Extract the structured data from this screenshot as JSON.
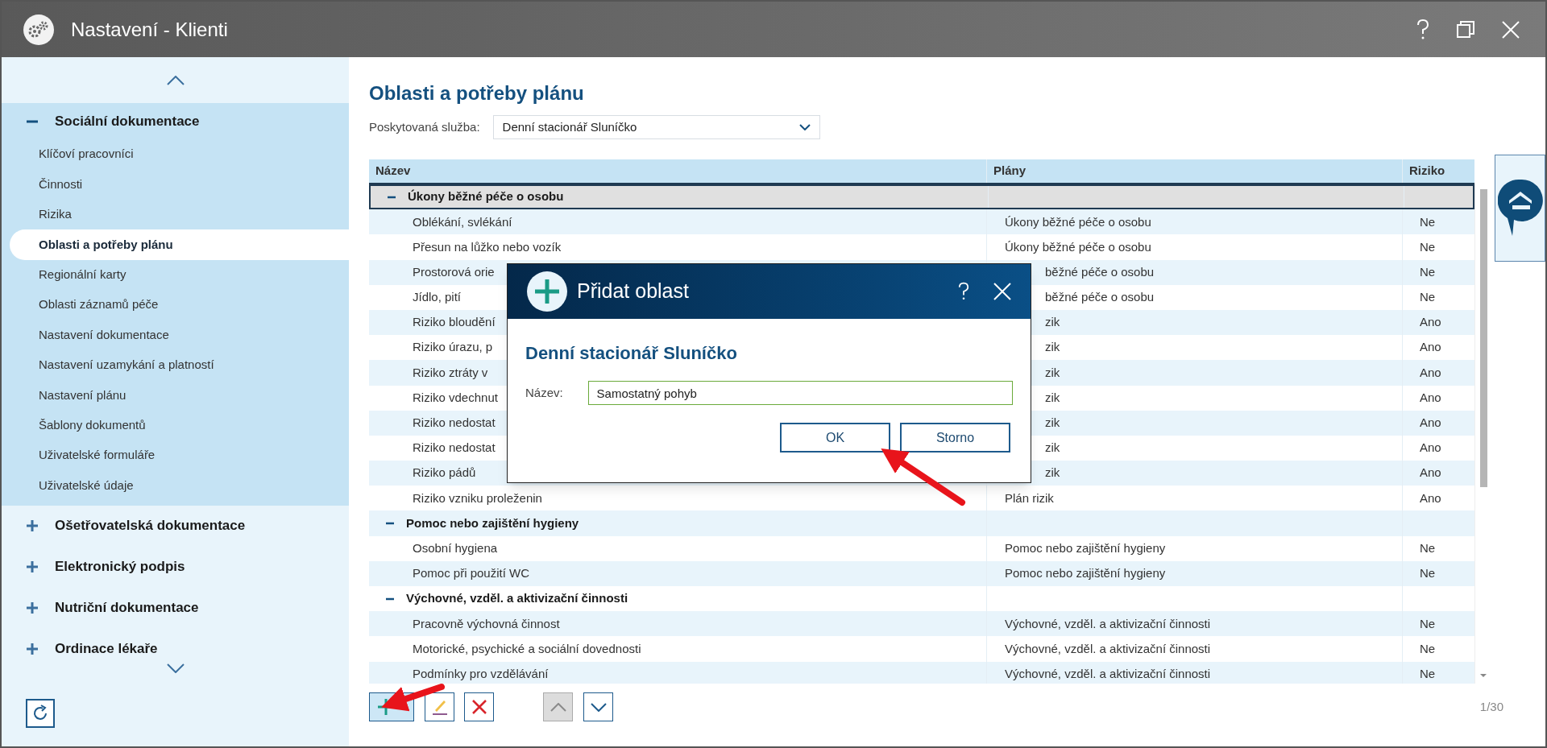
{
  "window": {
    "title": "Nastavení - Klienti"
  },
  "sidebar": {
    "sections": [
      {
        "label": "Sociální dokumentace",
        "expanded": true,
        "children": [
          {
            "label": "Klíčoví pracovníci",
            "selected": false
          },
          {
            "label": "Činnosti",
            "selected": false
          },
          {
            "label": "Rizika",
            "selected": false
          },
          {
            "label": "Oblasti a potřeby plánu",
            "selected": true
          },
          {
            "label": "Regionální karty",
            "selected": false
          },
          {
            "label": "Oblasti záznamů péče",
            "selected": false
          },
          {
            "label": "Nastavení dokumentace",
            "selected": false
          },
          {
            "label": "Nastavení uzamykání a platností",
            "selected": false
          },
          {
            "label": "Nastavení plánu",
            "selected": false
          },
          {
            "label": "Šablony dokumentů",
            "selected": false
          },
          {
            "label": "Uživatelské formuláře",
            "selected": false
          },
          {
            "label": "Uživatelské údaje",
            "selected": false
          }
        ]
      },
      {
        "label": "Ošetřovatelská dokumentace",
        "expanded": false
      },
      {
        "label": "Elektronický podpis",
        "expanded": false
      },
      {
        "label": "Nutriční dokumentace",
        "expanded": false
      },
      {
        "label": "Ordinace lékaře",
        "expanded": false
      }
    ]
  },
  "page": {
    "title": "Oblasti a potřeby plánu",
    "service_label": "Poskytovaná služba:",
    "service_value": "Denní stacionář Sluníčko"
  },
  "table": {
    "columns": [
      "Název",
      "Plány",
      "Riziko"
    ],
    "groups": [
      {
        "name": "Úkony běžné péče o osobu",
        "expanded": true,
        "selected": true,
        "children": [
          {
            "name": "Oblékání, svlékání",
            "plan": "Úkony běžné péče o osobu",
            "risk": "Ne",
            "selected": false
          },
          {
            "name": "Přesun na lůžko nebo vozík",
            "plan": "Úkony běžné péče o osobu",
            "risk": "Ne",
            "selected": false
          },
          {
            "name": "Prostorová orie",
            "plan": "běžné péče o osobu",
            "plan_covered": true,
            "risk": "Ne",
            "selected": false
          },
          {
            "name": "Jídlo, pití",
            "plan": "běžné péče o osobu",
            "plan_covered": true,
            "risk": "Ne",
            "selected": false
          },
          {
            "name": "Riziko bloudění",
            "plan": "zik",
            "plan_covered": true,
            "risk": "Ano",
            "selected": false
          },
          {
            "name": "Riziko úrazu, p",
            "plan": "zik",
            "plan_covered": true,
            "risk": "Ano",
            "selected": false
          },
          {
            "name": "Riziko ztráty v",
            "plan": "zik",
            "plan_covered": true,
            "risk": "Ano",
            "selected": false
          },
          {
            "name": "Riziko vdechnut",
            "plan": "zik",
            "plan_covered": true,
            "risk": "Ano",
            "selected": false
          },
          {
            "name": "Riziko nedostat",
            "plan": "zik",
            "plan_covered": true,
            "risk": "Ano",
            "selected": false
          },
          {
            "name": "Riziko nedostat",
            "plan": "zik",
            "plan_covered": true,
            "risk": "Ano",
            "selected": false
          },
          {
            "name": "Riziko pádů",
            "plan": "zik",
            "plan_covered": true,
            "risk": "Ano",
            "selected": false
          },
          {
            "name": "Riziko vzniku proleženin",
            "plan": "Plán rizik",
            "risk": "Ano",
            "selected": false
          }
        ]
      },
      {
        "name": "Pomoc nebo zajištění hygieny",
        "expanded": true,
        "selected": false,
        "children": [
          {
            "name": "Osobní hygiena",
            "plan": "Pomoc nebo zajištění hygieny",
            "risk": "Ne",
            "selected": false
          },
          {
            "name": "Pomoc při použití WC",
            "plan": "Pomoc nebo zajištění hygieny",
            "risk": "Ne",
            "selected": false
          }
        ]
      },
      {
        "name": "Výchovné, vzděl. a aktivizační činnosti",
        "expanded": true,
        "selected": false,
        "children": [
          {
            "name": "Pracovně výchovná činnost",
            "plan": "Výchovné, vzděl. a aktivizační činnosti",
            "risk": "Ne",
            "selected": false
          },
          {
            "name": "Motorické, psychické a sociální dovednosti",
            "plan": "Výchovné, vzděl. a aktivizační činnosti",
            "risk": "Ne",
            "selected": false
          },
          {
            "name": "Podmínky pro vzdělávání",
            "plan": "Výchovné, vzděl. a aktivizační činnosti",
            "risk": "Ne",
            "selected": false
          }
        ]
      }
    ]
  },
  "pager": "1/30",
  "dialog": {
    "title": "Přidat oblast",
    "heading": "Denní stacionář Sluníčko",
    "field_label": "Název:",
    "field_value": "Samostatný pohyb",
    "buttons": [
      "OK",
      "Storno"
    ]
  }
}
